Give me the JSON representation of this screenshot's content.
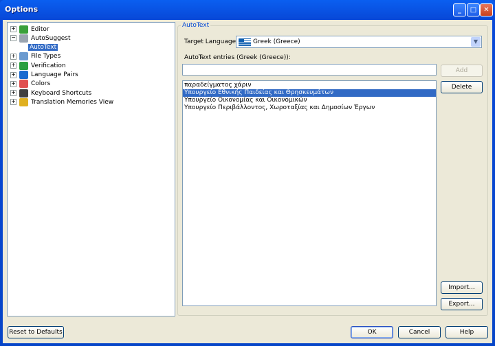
{
  "window": {
    "title": "Options"
  },
  "tree": [
    {
      "label": "Editor",
      "expander": "+",
      "color": "#3aa03a"
    },
    {
      "label": "AutoSuggest",
      "expander": "-",
      "color": "#9aa4b0"
    },
    {
      "label": "AutoText",
      "selected": true
    },
    {
      "label": "File Types",
      "expander": "+",
      "color": "#6a9ad0"
    },
    {
      "label": "Verification",
      "expander": "+",
      "color": "#2aa040"
    },
    {
      "label": "Language Pairs",
      "expander": "+",
      "color": "#1a6ad0"
    },
    {
      "label": "Colors",
      "expander": "+",
      "color": "#e05050"
    },
    {
      "label": "Keyboard Shortcuts",
      "expander": "+",
      "color": "#404040"
    },
    {
      "label": "Translation Memories View",
      "expander": "+",
      "color": "#e0b020"
    }
  ],
  "autotext": {
    "group_label": "AutoText",
    "target_language_label": "Target Language:",
    "target_language_value": "Greek (Greece)",
    "entries_label": "AutoText entries (Greek (Greece)):",
    "entry_input_value": "",
    "entries": [
      "παραδείγματος χάριν",
      "Υπουργείο Εθνικής Παιδείας και Θρησκευμάτων",
      "Υπουργείο Οικονομίας και Οικονομικών",
      "Υπουργείο Περιβάλλοντος, Χωροταξίας και Δημοσίων Έργων"
    ],
    "selected_index": 1,
    "add": "Add",
    "delete": "Delete",
    "import": "Import...",
    "export": "Export..."
  },
  "footer": {
    "reset": "Reset to Defaults",
    "ok": "OK",
    "cancel": "Cancel",
    "help": "Help"
  }
}
